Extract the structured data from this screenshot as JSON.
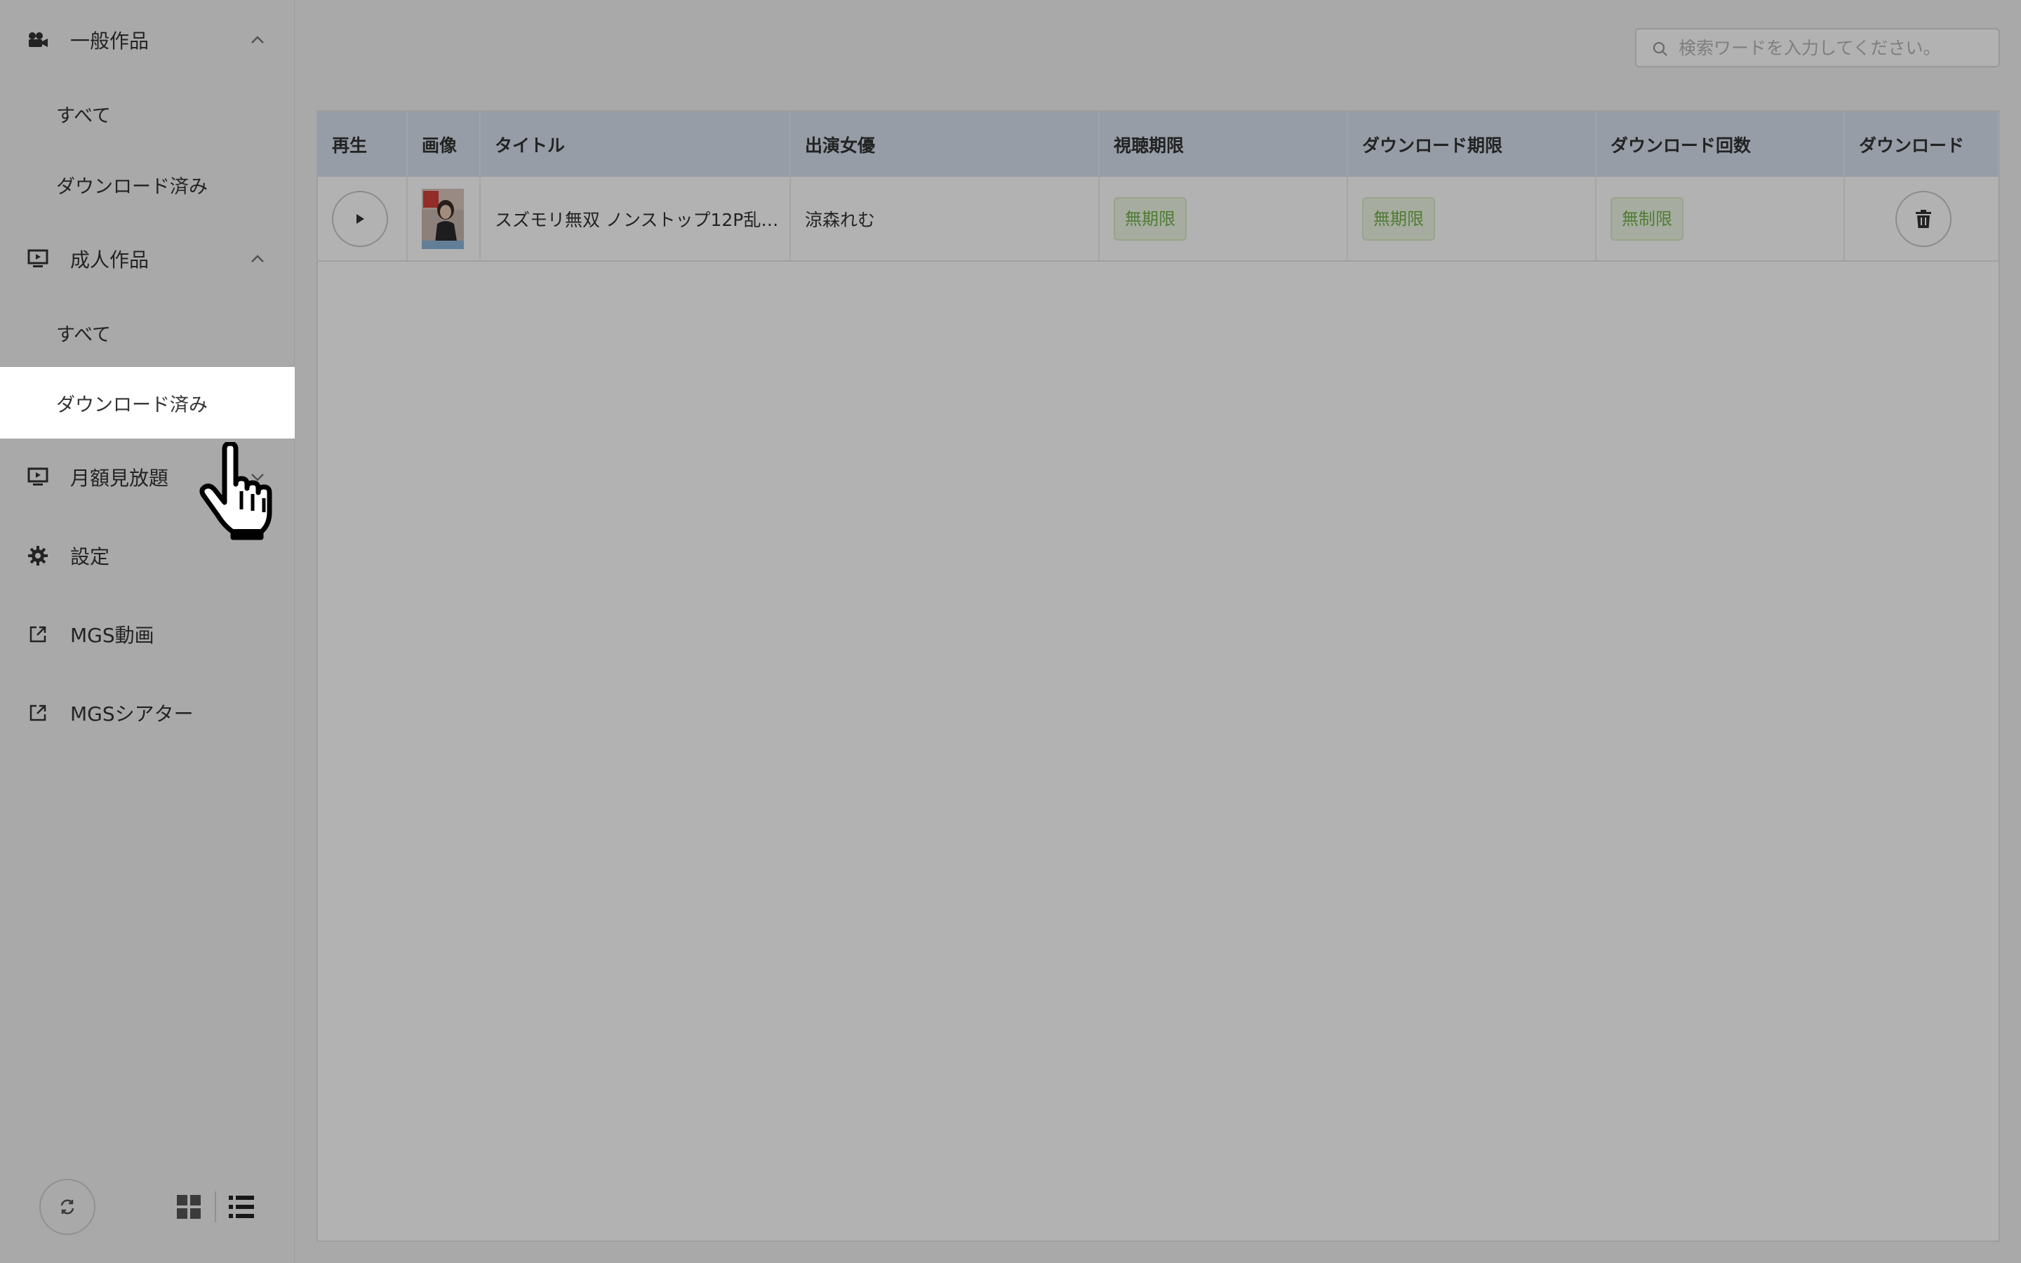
{
  "sidebar": {
    "groups": [
      {
        "label": "一般作品",
        "icon": "video-camera-icon",
        "expanded": true,
        "items": [
          {
            "label": "すべて"
          },
          {
            "label": "ダウンロード済み"
          }
        ]
      },
      {
        "label": "成人作品",
        "icon": "monitor-play-icon",
        "expanded": true,
        "items": [
          {
            "label": "すべて"
          },
          {
            "label": "ダウンロード済み",
            "active": true
          }
        ]
      },
      {
        "label": "月額見放題",
        "icon": "monitor-play-icon",
        "expanded": false
      }
    ],
    "menu": [
      {
        "label": "設定",
        "icon": "gear-icon"
      },
      {
        "label": "MGS動画",
        "icon": "external-link-icon"
      },
      {
        "label": "MGSシアター",
        "icon": "external-link-icon"
      }
    ],
    "footer": {
      "refresh_icon": "refresh-icon",
      "grid_icon": "grid-view-icon",
      "list_icon": "list-view-icon",
      "active_view": "list"
    }
  },
  "search": {
    "placeholder": "検索ワードを入力してください。",
    "value": ""
  },
  "table": {
    "columns": [
      "再生",
      "画像",
      "タイトル",
      "出演女優",
      "視聴期限",
      "ダウンロード期限",
      "ダウンロード回数",
      "ダウンロード"
    ],
    "rows": [
      {
        "title": "スズモリ無双 ノンストップ12P乱…",
        "actress": "涼森れむ",
        "view_limit": "無期限",
        "download_limit": "無期限",
        "download_count": "無制限"
      }
    ]
  },
  "colors": {
    "header_bg": "#d9e1ef",
    "tag_text": "#74b14c",
    "tag_bg": "#eef8e6"
  }
}
